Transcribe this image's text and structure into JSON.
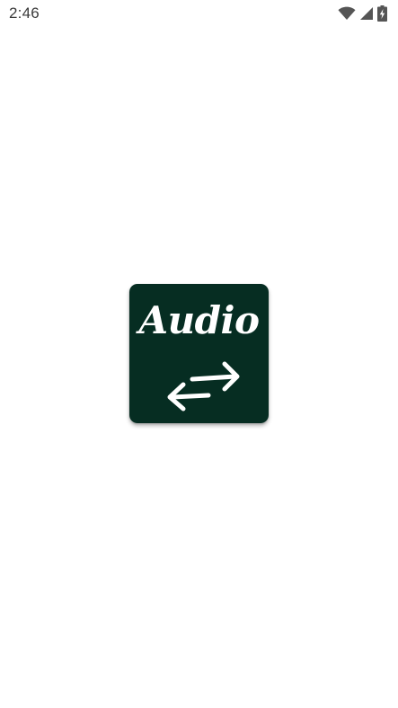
{
  "status_bar": {
    "time": "2:46",
    "icons": [
      "wifi-icon",
      "cellular-signal-icon",
      "battery-charging-icon"
    ]
  },
  "splash": {
    "logo_text": "Audio",
    "logo_icon": "swap-arrows-icon",
    "colors": {
      "logo_background": "#062d22",
      "logo_foreground": "#ffffff",
      "page_background": "#ffffff"
    }
  }
}
